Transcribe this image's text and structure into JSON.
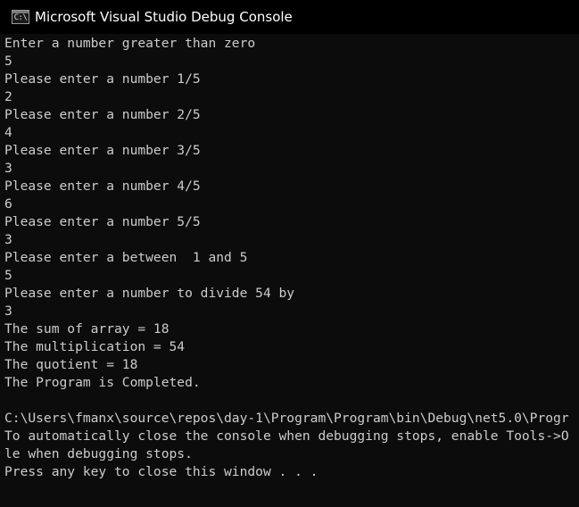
{
  "window": {
    "title": "Microsoft Visual Studio Debug Console",
    "icon": "console-app-icon",
    "icon_text": "C:\\"
  },
  "colors": {
    "background": "#0c0c0c",
    "titlebar": "#000000",
    "text": "#cccccc"
  },
  "console": {
    "lines": [
      "Enter a number greater than zero",
      "5",
      "Please enter a number 1/5",
      "2",
      "Please enter a number 2/5",
      "4",
      "Please enter a number 3/5",
      "3",
      "Please enter a number 4/5",
      "6",
      "Please enter a number 5/5",
      "3",
      "Please enter a between  1 and 5",
      "5",
      "Please enter a number to divide 54 by",
      "3",
      "The sum of array = 18",
      "The multiplication = 54",
      "The quotient = 18",
      "The Program is Completed.",
      "",
      "C:\\Users\\fmanx\\source\\repos\\day-1\\Program\\Program\\bin\\Debug\\net5.0\\Progr",
      "To automatically close the console when debugging stops, enable Tools->O",
      "le when debugging stops.",
      "Press any key to close this window . . ."
    ]
  }
}
